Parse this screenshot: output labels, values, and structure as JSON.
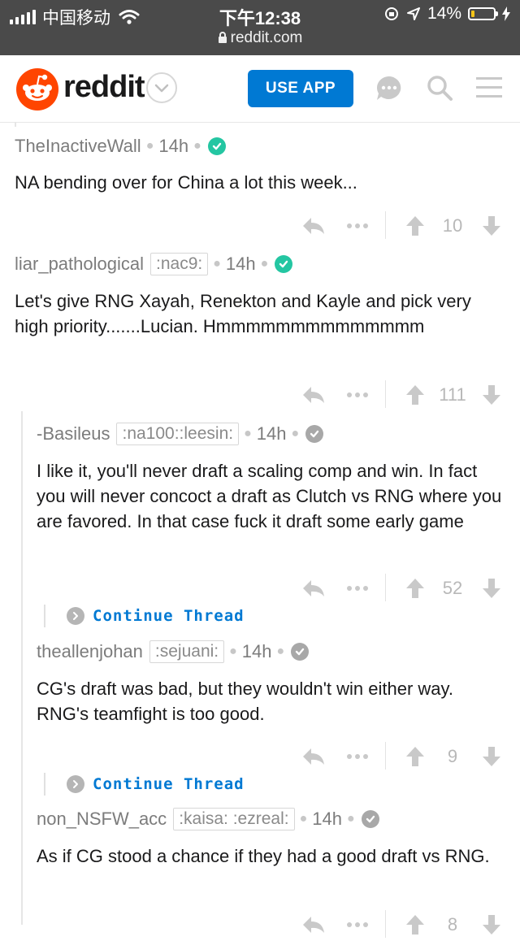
{
  "status_bar": {
    "carrier": "中国移动",
    "time": "下午12:38",
    "battery": "14%",
    "battery_level": 0.14,
    "url": "reddit.com"
  },
  "header": {
    "brand": "reddit",
    "use_app_label": "USE APP",
    "accent_color": "#0079d3",
    "logo_color": "#ff4500"
  },
  "comments": [
    {
      "author": "TheInactiveWall",
      "flair": "",
      "time": "14h",
      "body": "NA bending over for China a lot this week...",
      "score": "10"
    },
    {
      "author": "liar_pathological",
      "flair": ":nac9:",
      "time": "14h",
      "body": "Let's give RNG Xayah, Renekton and Kayle and pick very high priority.......Lucian. Hmmmmmmmmmmmmmm",
      "score": "111"
    },
    {
      "author": "-Basileus",
      "flair": ":na100::leesin:",
      "time": "14h",
      "body": "I like it, you'll never draft a scaling comp and win. In fact you will never concoct a draft as Clutch vs RNG where you are favored. In that case fuck it draft some early game",
      "score": "52"
    },
    {
      "author": "theallenjohan",
      "flair": ":sejuani:",
      "time": "14h",
      "body": "CG's draft was bad, but they wouldn't win either way. RNG's teamfight is too good.",
      "score": "9"
    },
    {
      "author": "non_NSFW_acc",
      "flair": ":kaisa: :ezreal:",
      "time": "14h",
      "body": "As if CG stood a chance if they had a good draft vs RNG.",
      "score": "8"
    }
  ],
  "continue_thread": [
    "Continue Thread",
    "Continue Thread"
  ]
}
